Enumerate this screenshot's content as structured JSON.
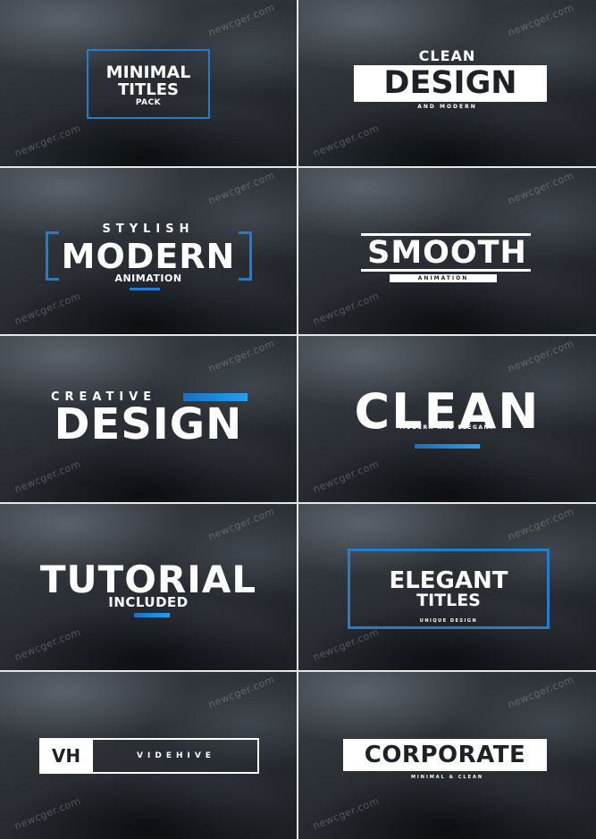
{
  "watermark": "newcger.com",
  "accent_color": "#1e7fd2",
  "panels": {
    "p1": {
      "line1": "MINIMAL",
      "line2": "TITLES",
      "line3": "PACK"
    },
    "p2": {
      "line1": "CLEAN",
      "line2": "DESIGN",
      "line3": "AND MODERN"
    },
    "p3": {
      "line1": "STYLISH",
      "line2": "MODERN",
      "line3": "ANIMATION"
    },
    "p4": {
      "line1": "SMOOTH",
      "line2": "ANIMATION"
    },
    "p5": {
      "line1": "CREATIVE",
      "line2": "DESIGN"
    },
    "p6": {
      "line1": "CLEAN",
      "line2": "MODERN AND ELEGANT"
    },
    "p7": {
      "line1": "TUTORIAL",
      "line2": "INCLUDED"
    },
    "p8": {
      "line1": "ELEGANT",
      "line2": "TITLES",
      "line3": "UNIQUE DESIGN"
    },
    "p9": {
      "line1": "VH",
      "line2": "VIDEHIVE"
    },
    "p10": {
      "line1": "CORPORATE",
      "line2": "MINIMAL & CLEAN"
    }
  }
}
